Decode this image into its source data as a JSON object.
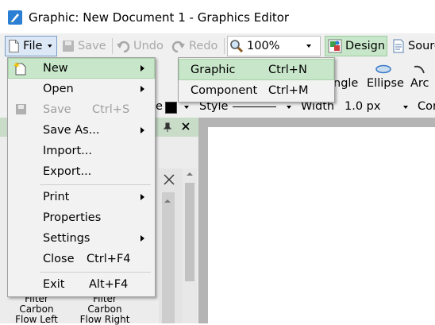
{
  "window": {
    "title": "Graphic: New Document 1 - Graphics Editor"
  },
  "toolbar": {
    "file_label": "File",
    "save_label": "Save",
    "undo_label": "Undo",
    "redo_label": "Redo",
    "zoom_value": "100%",
    "design_label": "Design",
    "source_label": "Sourc"
  },
  "shapes": {
    "rectangle_label": "ngle",
    "ellipse_label": "Ellipse",
    "arc_label": "Arc"
  },
  "stylebar": {
    "fill_label": "e",
    "style_label": "Style",
    "width_label": "Width",
    "width_value": "1.0 px",
    "corner_label": "Cor"
  },
  "panel": {
    "items": [
      {
        "label": "Filter Carbon\nFlow Left"
      },
      {
        "label": "Filter Carbon\nFlow Right"
      }
    ]
  },
  "file_menu": {
    "items": [
      {
        "label": "New",
        "shortcut": "",
        "submenu": true
      },
      {
        "label": "Open",
        "shortcut": "",
        "submenu": true
      },
      {
        "label": "Save",
        "shortcut": "Ctrl+S",
        "submenu": false
      },
      {
        "label": "Save As...",
        "shortcut": "",
        "submenu": true
      },
      {
        "label": "Import...",
        "shortcut": ""
      },
      {
        "label": "Export...",
        "shortcut": ""
      },
      {
        "label": "Print",
        "shortcut": "",
        "submenu": true
      },
      {
        "label": "Properties",
        "shortcut": ""
      },
      {
        "label": "Settings",
        "shortcut": "",
        "submenu": true
      },
      {
        "label": "Close",
        "shortcut": "Ctrl+F4"
      },
      {
        "label": "Exit",
        "shortcut": "Alt+F4"
      }
    ]
  },
  "new_submenu": {
    "items": [
      {
        "label": "Graphic",
        "shortcut": "Ctrl+N"
      },
      {
        "label": "Component",
        "shortcut": "Ctrl+M"
      }
    ]
  },
  "colors": {
    "highlight": "#c8e6c9",
    "accent": "#1e6fbf"
  }
}
